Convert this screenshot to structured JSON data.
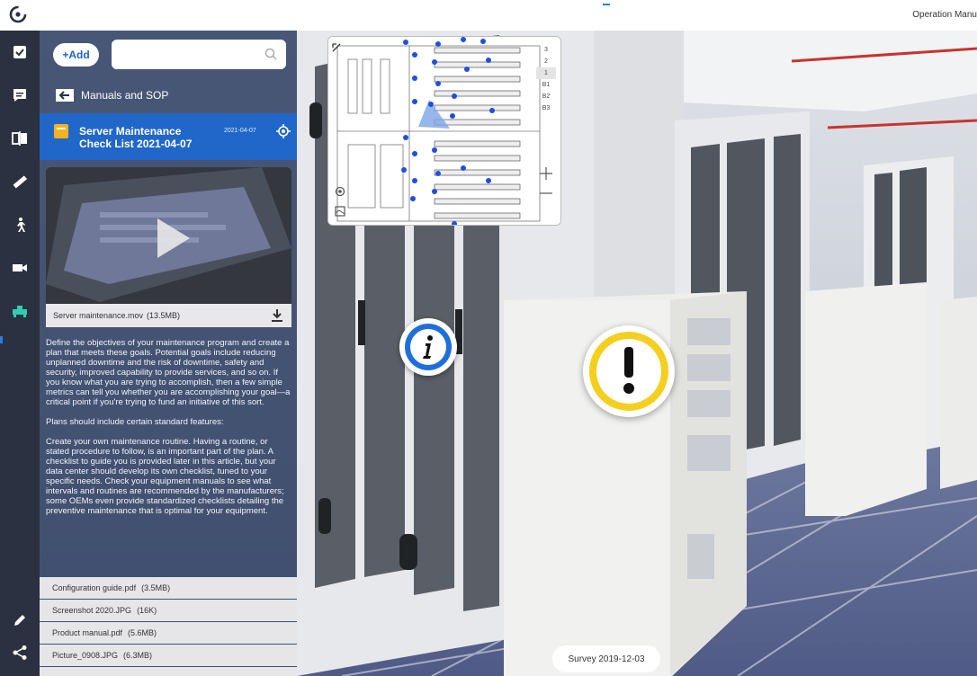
{
  "app": {
    "title": "Operation Manu"
  },
  "panel": {
    "add_label": "+Add",
    "search_placeholder": "",
    "back_label": "Manuals and SOP",
    "item": {
      "title": "Server Maintenance Check List 2021-04-07",
      "date": "2021-04-07"
    },
    "video": {
      "filename": "Server maintenance.mov",
      "size": "(13.5MB)"
    },
    "description": [
      "Define the objectives of your maintenance program and create a plan that meets these goals. Potential goals include reducing unplanned downtime and the risk of downtime, safety and security, improved capability to provide services, and so on. If you know what you are trying to accomplish, then a few simple metrics can tell you whether you are accomplishing your goal—a critical point if you're trying to fund an initiative of this sort.",
      "Plans should include certain standard features:",
      "Create your own maintenance routine. Having a routine, or stated procedure to follow, is an important part of the plan. A checklist to guide you is provided later in this article, but your data center should develop its own checklist, tuned to your specific needs. Check your equipment manuals to see what intervals and routines are recommended by the manufacturers; some OEMs even provide standardized checklists detailing the preventive maintenance that is optimal for your equipment."
    ],
    "files": [
      {
        "name": "Configuration guide.pdf",
        "size": "(3.5MB)"
      },
      {
        "name": "Screenshot 2020.JPG",
        "size": "(16K)"
      },
      {
        "name": "Product manual.pdf",
        "size": "(5.6MB)"
      },
      {
        "name": "Picture_0908.JPG",
        "size": "(6.3MB)"
      }
    ]
  },
  "rail": {
    "icons": [
      "checkbox-icon",
      "comment-icon",
      "compare-icon",
      "ruler-icon",
      "walk-icon",
      "video-icon",
      "pipe-icon",
      "pencil-icon",
      "share-icon"
    ]
  },
  "map": {
    "floors": [
      "3",
      "2",
      "1",
      "B1",
      "B2",
      "B3"
    ],
    "active_floor": "1"
  },
  "survey": {
    "label": "Survey 2019-12-03"
  },
  "colors": {
    "accent": "#2067c9",
    "warning": "#f5cf1f",
    "info": "#1f6fdb"
  }
}
